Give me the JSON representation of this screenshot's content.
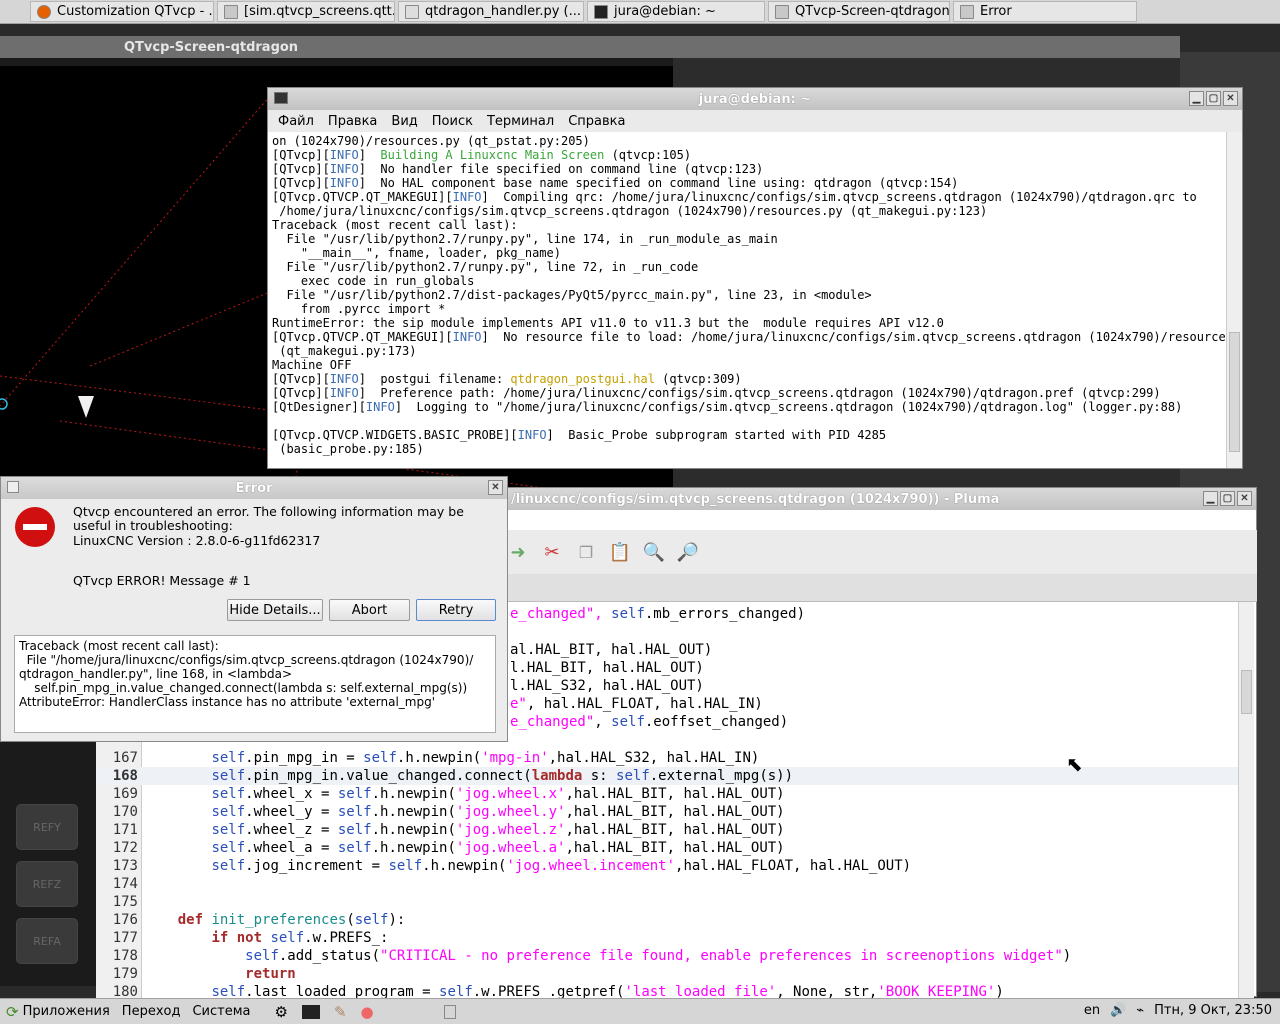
{
  "top_taskbar": {
    "tasks": [
      {
        "label": "Customization QTvcp - ...",
        "icon": "firefox-icon"
      },
      {
        "label": "[sim.qtvcp_screens.qtt...",
        "icon": "folder-icon"
      },
      {
        "label": "qtdragon_handler.py (...",
        "icon": "editor-icon"
      },
      {
        "label": "jura@debian: ~",
        "icon": "terminal-icon"
      },
      {
        "label": "QTvcp-Screen-qtdragon",
        "icon": "window-icon"
      },
      {
        "label": "Error",
        "icon": "window-icon"
      }
    ]
  },
  "background_window": {
    "title": "QTvcp-Screen-qtdragon",
    "ref_buttons": [
      "REFY",
      "REFZ",
      "REFA"
    ]
  },
  "terminal": {
    "title": "jura@debian: ~",
    "menu": [
      "Файл",
      "Правка",
      "Вид",
      "Поиск",
      "Терминал",
      "Справка"
    ],
    "lines": [
      [
        {
          "t": "on (1024x790)/resources.py (qt_pstat.py:205)"
        }
      ],
      [
        {
          "t": "[QTvcp]["
        },
        {
          "t": "INFO",
          "c": "info"
        },
        {
          "t": "]  "
        },
        {
          "t": "Building A Linuxcnc Main Screen",
          "c": "grn"
        },
        {
          "t": " (qtvcp:105)"
        }
      ],
      [
        {
          "t": "[QTvcp]["
        },
        {
          "t": "INFO",
          "c": "info"
        },
        {
          "t": "]  No handler file specified on command line (qtvcp:123)"
        }
      ],
      [
        {
          "t": "[QTvcp]["
        },
        {
          "t": "INFO",
          "c": "info"
        },
        {
          "t": "]  No HAL component base name specified on command line using: qtdragon (qtvcp:154)"
        }
      ],
      [
        {
          "t": "[QTvcp.QTVCP.QT_MAKEGUI]["
        },
        {
          "t": "INFO",
          "c": "info"
        },
        {
          "t": "]  Compiling qrc: /home/jura/linuxcnc/configs/sim.qtvcp_screens.qtdragon (1024x790)/qtdragon.qrc to"
        }
      ],
      [
        {
          "t": " /home/jura/linuxcnc/configs/sim.qtvcp_screens.qtdragon (1024x790)/resources.py (qt_makegui.py:123)"
        }
      ],
      [
        {
          "t": "Traceback (most recent call last):"
        }
      ],
      [
        {
          "t": "  File \"/usr/lib/python2.7/runpy.py\", line 174, in _run_module_as_main"
        }
      ],
      [
        {
          "t": "    \"__main__\", fname, loader, pkg_name)"
        }
      ],
      [
        {
          "t": "  File \"/usr/lib/python2.7/runpy.py\", line 72, in _run_code"
        }
      ],
      [
        {
          "t": "    exec code in run_globals"
        }
      ],
      [
        {
          "t": "  File \"/usr/lib/python2.7/dist-packages/PyQt5/pyrcc_main.py\", line 23, in <module>"
        }
      ],
      [
        {
          "t": "    from .pyrcc import *"
        }
      ],
      [
        {
          "t": "RuntimeError: the sip module implements API v11.0 to v11.3 but the  module requires API v12.0"
        }
      ],
      [
        {
          "t": "[QTvcp.QTVCP.QT_MAKEGUI]["
        },
        {
          "t": "INFO",
          "c": "info"
        },
        {
          "t": "]  No resource file to load: /home/jura/linuxcnc/configs/sim.qtvcp_screens.qtdragon (1024x790)/resources.py"
        }
      ],
      [
        {
          "t": " (qt_makegui.py:173)"
        }
      ],
      [
        {
          "t": "Machine OFF"
        }
      ],
      [
        {
          "t": "[QTvcp]["
        },
        {
          "t": "INFO",
          "c": "info"
        },
        {
          "t": "]  postgui filename: "
        },
        {
          "t": "qtdragon_postgui.hal",
          "c": "yel"
        },
        {
          "t": " (qtvcp:309)"
        }
      ],
      [
        {
          "t": "[QTvcp]["
        },
        {
          "t": "INFO",
          "c": "info"
        },
        {
          "t": "]  Preference path: /home/jura/linuxcnc/configs/sim.qtvcp_screens.qtdragon (1024x790)/qtdragon.pref (qtvcp:299)"
        }
      ],
      [
        {
          "t": "[QtDesigner]["
        },
        {
          "t": "INFO",
          "c": "info"
        },
        {
          "t": "]  Logging to \"/home/jura/linuxcnc/configs/sim.qtvcp_screens.qtdragon (1024x790)/qtdragon.log\" (logger.py:88)"
        }
      ],
      [
        {
          "t": ""
        }
      ],
      [
        {
          "t": "[QTvcp.QTVCP.WIDGETS.BASIC_PROBE]["
        },
        {
          "t": "INFO",
          "c": "info"
        },
        {
          "t": "]  Basic_Probe subprogram started with PID 4285"
        }
      ],
      [
        {
          "t": " (basic_probe.py:185)"
        }
      ]
    ]
  },
  "pluma": {
    "title": "/linuxcnc/configs/sim.qtvcp_screens.qtdragon (1024x790)) - Pluma",
    "partial_lines": [
      [
        {
          "t": "e_changed\", ",
          "c": "str"
        },
        {
          "t": "self",
          "c": "slf"
        },
        {
          "t": ".mb_errors_changed)"
        }
      ],
      [
        {
          "t": ""
        }
      ],
      [
        {
          "t": "al.HAL_BIT, hal.HAL_OUT)"
        }
      ],
      [
        {
          "t": "l.HAL_BIT, hal.HAL_OUT)"
        }
      ],
      [
        {
          "t": "l.HAL_S32, hal.HAL_OUT)"
        }
      ],
      [
        {
          "t": "e\"",
          "c": "str"
        },
        {
          "t": ", hal.HAL_FLOAT, hal.HAL_IN)"
        }
      ],
      [
        {
          "t": "e_changed\"",
          "c": "str"
        },
        {
          "t": ", "
        },
        {
          "t": "self",
          "c": "slf"
        },
        {
          "t": ".eoffset_changed)"
        }
      ]
    ],
    "lines": [
      {
        "n": "167",
        "segs": [
          {
            "t": "        "
          },
          {
            "t": "self",
            "c": "slf"
          },
          {
            "t": ".pin_mpg_in = "
          },
          {
            "t": "self",
            "c": "slf"
          },
          {
            "t": ".h.newpin("
          },
          {
            "t": "'mpg-in'",
            "c": "str"
          },
          {
            "t": ",hal.HAL_S32, hal.HAL_IN)"
          }
        ]
      },
      {
        "n": "168",
        "hl": true,
        "segs": [
          {
            "t": "        "
          },
          {
            "t": "self",
            "c": "slf"
          },
          {
            "t": ".pin_mpg_in.value_changed.connect("
          },
          {
            "t": "lambda",
            "c": "kw"
          },
          {
            "t": " s: "
          },
          {
            "t": "self",
            "c": "slf"
          },
          {
            "t": ".external_mpg(s))"
          }
        ]
      },
      {
        "n": "169",
        "segs": [
          {
            "t": "        "
          },
          {
            "t": "self",
            "c": "slf"
          },
          {
            "t": ".wheel_x = "
          },
          {
            "t": "self",
            "c": "slf"
          },
          {
            "t": ".h.newpin("
          },
          {
            "t": "'jog.wheel.x'",
            "c": "str"
          },
          {
            "t": ",hal.HAL_BIT, hal.HAL_OUT)"
          }
        ]
      },
      {
        "n": "170",
        "segs": [
          {
            "t": "        "
          },
          {
            "t": "self",
            "c": "slf"
          },
          {
            "t": ".wheel_y = "
          },
          {
            "t": "self",
            "c": "slf"
          },
          {
            "t": ".h.newpin("
          },
          {
            "t": "'jog.wheel.y'",
            "c": "str"
          },
          {
            "t": ",hal.HAL_BIT, hal.HAL_OUT)"
          }
        ]
      },
      {
        "n": "171",
        "segs": [
          {
            "t": "        "
          },
          {
            "t": "self",
            "c": "slf"
          },
          {
            "t": ".wheel_z = "
          },
          {
            "t": "self",
            "c": "slf"
          },
          {
            "t": ".h.newpin("
          },
          {
            "t": "'jog.wheel.z'",
            "c": "str"
          },
          {
            "t": ",hal.HAL_BIT, hal.HAL_OUT)"
          }
        ]
      },
      {
        "n": "172",
        "segs": [
          {
            "t": "        "
          },
          {
            "t": "self",
            "c": "slf"
          },
          {
            "t": ".wheel_a = "
          },
          {
            "t": "self",
            "c": "slf"
          },
          {
            "t": ".h.newpin("
          },
          {
            "t": "'jog.wheel.a'",
            "c": "str"
          },
          {
            "t": ",hal.HAL_BIT, hal.HAL_OUT)"
          }
        ]
      },
      {
        "n": "173",
        "segs": [
          {
            "t": "        "
          },
          {
            "t": "self",
            "c": "slf"
          },
          {
            "t": ".jog_increment = "
          },
          {
            "t": "self",
            "c": "slf"
          },
          {
            "t": ".h.newpin("
          },
          {
            "t": "'jog.wheel.incement'",
            "c": "str"
          },
          {
            "t": ",hal.HAL_FLOAT, hal.HAL_OUT)"
          }
        ]
      },
      {
        "n": "174",
        "segs": [
          {
            "t": ""
          }
        ]
      },
      {
        "n": "175",
        "segs": [
          {
            "t": ""
          }
        ]
      },
      {
        "n": "176",
        "segs": [
          {
            "t": "    "
          },
          {
            "t": "def",
            "c": "kw"
          },
          {
            "t": " "
          },
          {
            "t": "init_preferences",
            "c": "fn"
          },
          {
            "t": "("
          },
          {
            "t": "self",
            "c": "slf"
          },
          {
            "t": "):"
          }
        ]
      },
      {
        "n": "177",
        "segs": [
          {
            "t": "        "
          },
          {
            "t": "if not",
            "c": "kw"
          },
          {
            "t": " "
          },
          {
            "t": "self",
            "c": "slf"
          },
          {
            "t": ".w.PREFS_:"
          }
        ]
      },
      {
        "n": "178",
        "segs": [
          {
            "t": "            "
          },
          {
            "t": "self",
            "c": "slf"
          },
          {
            "t": ".add_status("
          },
          {
            "t": "\"CRITICAL - no preference file found, enable preferences in screenoptions widget\"",
            "c": "str"
          },
          {
            "t": ")"
          }
        ]
      },
      {
        "n": "179",
        "segs": [
          {
            "t": "            "
          },
          {
            "t": "return",
            "c": "kw"
          }
        ]
      },
      {
        "n": "180",
        "segs": [
          {
            "t": "        "
          },
          {
            "t": "self",
            "c": "slf"
          },
          {
            "t": ".last_loaded_program = "
          },
          {
            "t": "self",
            "c": "slf"
          },
          {
            "t": ".w.PREFS_.getpref("
          },
          {
            "t": "'last_loaded_file'",
            "c": "str"
          },
          {
            "t": ", None, str,"
          },
          {
            "t": "'BOOK_KEEPING'",
            "c": "str"
          },
          {
            "t": ")"
          }
        ]
      }
    ]
  },
  "error_dialog": {
    "title": "Error",
    "message": "Qtvcp encountered an error.  The following information may be useful in troubleshooting:",
    "version": "LinuxCNC Version  : 2.8.0-6-g11fd62317",
    "error_num": "QTvcp ERROR! Message # 1",
    "hide_details": "Hide Details...",
    "abort": "Abort",
    "retry": "Retry",
    "details": "Traceback (most recent call last):\n  File \"/home/jura/linuxcnc/configs/sim.qtvcp_screens.qtdragon (1024x790)/\nqtdragon_handler.py\", line 168, in <lambda>\n    self.pin_mpg_in.value_changed.connect(lambda s: self.external_mpg(s))\nAttributeError: HandlerClass instance has no attribute 'external_mpg'"
  },
  "bottom_taskbar": {
    "menus": [
      "Приложения",
      "Переход",
      "Система"
    ],
    "lang": "en",
    "clock": "Птн, 9 Окт, 23:50"
  },
  "colors": {
    "info": "#3a6cb2",
    "error_red": "#d01010"
  }
}
